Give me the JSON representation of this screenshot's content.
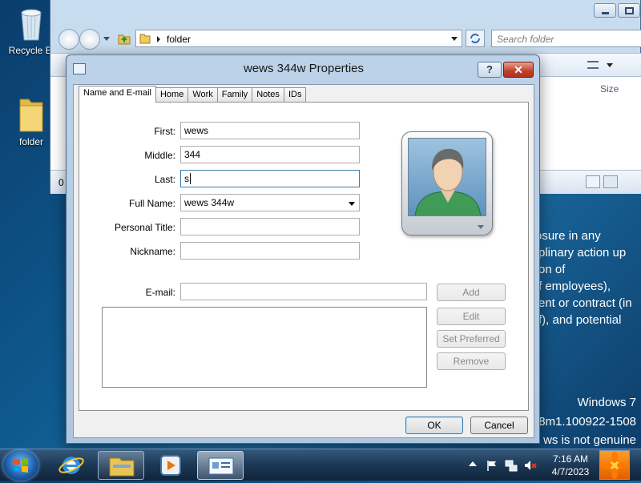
{
  "desktop": {
    "icons": [
      {
        "label": "Recycle Bi"
      },
      {
        "label": "folder"
      }
    ],
    "background_text_lines": [
      "osure in any",
      "plinary action up",
      "on of",
      "f employees),",
      "ent or contract (in",
      "f), and potential"
    ],
    "watermark": {
      "line1": "Windows 7",
      "line2": "8m1.100922-1508",
      "line3": "ws is not genuine"
    }
  },
  "explorer": {
    "address_path": "folder",
    "search_placeholder": "Search folder",
    "column_size": "Size",
    "status_count": "0"
  },
  "dialog": {
    "title": "wews 344w Properties",
    "help_label": "?",
    "close_label": "✕",
    "tabs": [
      {
        "label": "Name and E-mail"
      },
      {
        "label": "Home"
      },
      {
        "label": "Work"
      },
      {
        "label": "Family"
      },
      {
        "label": "Notes"
      },
      {
        "label": "IDs"
      }
    ],
    "fields": {
      "first": {
        "label": "First:",
        "value": "wews"
      },
      "middle": {
        "label": "Middle:",
        "value": "344"
      },
      "last": {
        "label": "Last:",
        "value": "s"
      },
      "full_name": {
        "label": "Full Name:",
        "value": "wews 344w"
      },
      "personal_title": {
        "label": "Personal Title:",
        "value": ""
      },
      "nickname": {
        "label": "Nickname:",
        "value": ""
      },
      "email": {
        "label": "E-mail:",
        "value": ""
      }
    },
    "email_buttons": {
      "add": "Add",
      "edit": "Edit",
      "set_preferred": "Set Preferred",
      "remove": "Remove"
    },
    "ok_label": "OK",
    "cancel_label": "Cancel"
  },
  "taskbar": {
    "time": "7:16 AM",
    "date": "4/7/2023"
  }
}
